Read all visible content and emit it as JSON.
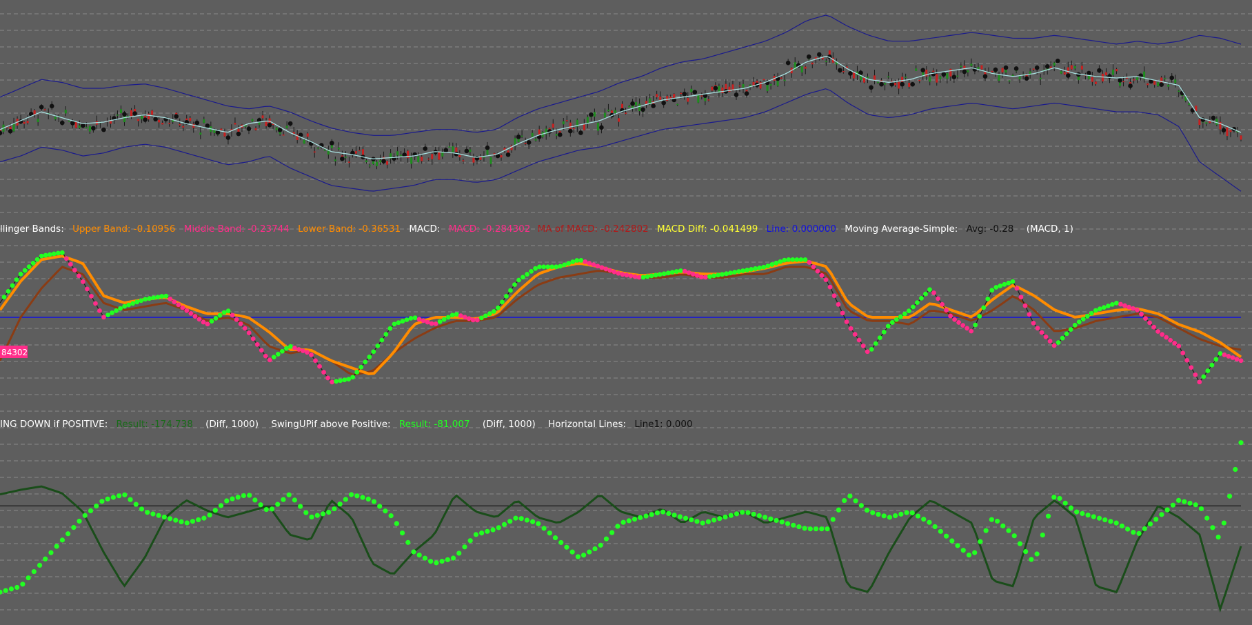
{
  "colors": {
    "background": "#5e5e5e",
    "grid": "#8a8a8a",
    "bollinger_band": "#1a1a8c",
    "middle_band": "#a8e0e0",
    "candle_up": "#1e8c1e",
    "candle_down": "#c82020",
    "candle_dot": "#111111",
    "macd": "#ff2d8a",
    "ma_of_macd": "#8a3c14",
    "macd_diff_line": "#ff8c00",
    "swing_dot": "#22ff22",
    "zero_line": "#1010e0",
    "result_line": "#1a4d1a",
    "black_line": "#111111"
  },
  "legend_macd": {
    "title": "llinger Bands:",
    "upper": "Upper Band: -0.10956",
    "middle": "Middle Band: -0.23744",
    "lower": "Lower Band: -0.36531",
    "macd_title": "MACD:",
    "macd": "MACD: -0.284302",
    "ma_macd": "MA of MACD: -0.242802",
    "diff": "MACD Diff: -0.041499",
    "line": "Line: 0.000000",
    "ma_title": "Moving Average-Simple:",
    "avg": "Avg: -0.28",
    "params": "(MACD, 1)",
    "value_tag": "84302"
  },
  "legend_swing": {
    "title": "ING DOWN if POSITIVE:",
    "result1": "Result: -174.738",
    "params1": "(Diff, 1000)",
    "title2": "SwingUPif above Positive:",
    "result2": "Result: -81.007",
    "params2": "(Diff, 1000)",
    "title3": "Horizontal Lines:",
    "line1": "Line1: 0.000"
  },
  "chart_data": [
    {
      "type": "line",
      "title": "",
      "description": "Price candles with Bollinger Bands (upper, middle, lower) — approximate normalized price",
      "x": [
        0,
        5,
        10,
        15,
        20,
        25,
        30,
        35,
        40,
        45,
        50,
        55,
        60,
        65,
        70,
        75,
        80,
        85,
        90,
        95,
        100,
        105,
        110,
        115,
        120,
        125,
        130,
        135,
        140,
        145,
        150,
        155,
        160,
        165,
        170,
        175,
        180,
        185,
        190,
        195,
        200,
        205,
        210,
        215,
        220,
        225,
        230,
        235,
        240,
        245,
        250,
        255,
        260,
        265,
        270,
        275,
        280,
        285,
        290,
        295,
        300
      ],
      "series": [
        {
          "name": "Middle Band",
          "values": [
            62,
            68,
            74,
            70,
            66,
            67,
            70,
            72,
            70,
            66,
            63,
            60,
            66,
            68,
            60,
            54,
            47,
            45,
            42,
            43,
            44,
            47,
            46,
            43,
            45,
            52,
            58,
            62,
            65,
            68,
            74,
            78,
            82,
            84,
            86,
            88,
            90,
            94,
            100,
            108,
            112,
            103,
            96,
            94,
            96,
            100,
            102,
            104,
            100,
            98,
            100,
            104,
            100,
            98,
            97,
            98,
            95,
            92,
            70,
            66,
            60
          ]
        },
        {
          "name": "Upper Band",
          "values": [
            84,
            90,
            96,
            94,
            90,
            90,
            92,
            93,
            90,
            86,
            82,
            78,
            76,
            78,
            74,
            68,
            63,
            60,
            58,
            58,
            60,
            62,
            62,
            60,
            62,
            70,
            76,
            80,
            84,
            88,
            94,
            98,
            104,
            108,
            110,
            114,
            118,
            122,
            128,
            136,
            140,
            132,
            126,
            122,
            122,
            124,
            126,
            128,
            126,
            124,
            124,
            126,
            124,
            122,
            120,
            122,
            120,
            122,
            126,
            124,
            120
          ]
        },
        {
          "name": "Lower Band",
          "values": [
            40,
            44,
            50,
            48,
            44,
            46,
            50,
            52,
            50,
            46,
            42,
            38,
            40,
            44,
            36,
            30,
            24,
            22,
            20,
            22,
            24,
            28,
            28,
            26,
            28,
            34,
            40,
            44,
            48,
            50,
            54,
            58,
            62,
            64,
            66,
            68,
            70,
            74,
            80,
            86,
            90,
            80,
            72,
            70,
            72,
            76,
            78,
            80,
            78,
            76,
            78,
            80,
            78,
            76,
            74,
            74,
            72,
            64,
            40,
            30,
            20
          ]
        }
      ],
      "xlabel": "",
      "ylabel": "",
      "ylim": [
        0,
        150
      ]
    },
    {
      "type": "line",
      "title": "",
      "description": "MACD panel — MACD line, MA of MACD, MACD Diff smoothing, zero line",
      "x": [
        0,
        5,
        10,
        15,
        20,
        25,
        30,
        35,
        40,
        45,
        50,
        55,
        60,
        65,
        70,
        75,
        80,
        85,
        90,
        95,
        100,
        105,
        110,
        115,
        120,
        125,
        130,
        135,
        140,
        145,
        150,
        155,
        160,
        165,
        170,
        175,
        180,
        185,
        190,
        195,
        200,
        205,
        210,
        215,
        220,
        225,
        230,
        235,
        240,
        245,
        250,
        255,
        260,
        265,
        270,
        275,
        280,
        285,
        290,
        295,
        300
      ],
      "series": [
        {
          "name": "MACD",
          "values": [
            0.2,
            0.6,
            0.85,
            0.9,
            0.5,
            0.0,
            0.15,
            0.25,
            0.3,
            0.1,
            -0.1,
            0.1,
            -0.2,
            -0.6,
            -0.4,
            -0.5,
            -0.9,
            -0.85,
            -0.5,
            -0.1,
            0.0,
            -0.1,
            0.05,
            -0.05,
            0.1,
            0.5,
            0.7,
            0.7,
            0.8,
            0.7,
            0.6,
            0.55,
            0.6,
            0.65,
            0.55,
            0.6,
            0.65,
            0.7,
            0.8,
            0.8,
            0.5,
            -0.1,
            -0.5,
            -0.1,
            0.1,
            0.4,
            0.0,
            -0.2,
            0.4,
            0.5,
            -0.1,
            -0.4,
            -0.1,
            0.1,
            0.2,
            0.1,
            -0.2,
            -0.4,
            -0.9,
            -0.5,
            -0.6
          ]
        },
        {
          "name": "MA of MACD",
          "values": [
            -0.6,
            0.0,
            0.4,
            0.7,
            0.6,
            0.2,
            0.1,
            0.15,
            0.2,
            0.1,
            -0.05,
            0.0,
            -0.1,
            -0.4,
            -0.5,
            -0.45,
            -0.6,
            -0.8,
            -0.75,
            -0.5,
            -0.3,
            -0.15,
            -0.05,
            -0.05,
            0.0,
            0.25,
            0.45,
            0.55,
            0.6,
            0.65,
            0.6,
            0.55,
            0.55,
            0.6,
            0.55,
            0.55,
            0.6,
            0.6,
            0.7,
            0.7,
            0.6,
            0.1,
            -0.05,
            -0.05,
            -0.1,
            0.1,
            0.05,
            -0.05,
            0.1,
            0.3,
            0.1,
            -0.2,
            -0.15,
            -0.05,
            0.0,
            0.05,
            0.0,
            -0.15,
            -0.3,
            -0.4,
            -0.45
          ]
        },
        {
          "name": "MACD Diff",
          "values": [
            0.1,
            0.5,
            0.8,
            0.85,
            0.75,
            0.3,
            0.2,
            0.25,
            0.28,
            0.15,
            0.05,
            0.05,
            0.0,
            -0.2,
            -0.45,
            -0.45,
            -0.6,
            -0.7,
            -0.8,
            -0.5,
            -0.1,
            0.0,
            0.0,
            -0.02,
            0.05,
            0.35,
            0.6,
            0.7,
            0.75,
            0.7,
            0.62,
            0.58,
            0.6,
            0.63,
            0.6,
            0.6,
            0.63,
            0.68,
            0.75,
            0.78,
            0.7,
            0.2,
            0.0,
            0.0,
            0.0,
            0.2,
            0.1,
            0.0,
            0.25,
            0.45,
            0.3,
            0.1,
            0.0,
            0.05,
            0.1,
            0.12,
            0.05,
            -0.1,
            -0.2,
            -0.35,
            -0.55
          ]
        },
        {
          "name": "Line",
          "values": [
            0,
            0,
            0,
            0,
            0,
            0,
            0,
            0,
            0,
            0,
            0,
            0,
            0,
            0,
            0,
            0,
            0,
            0,
            0,
            0,
            0,
            0,
            0,
            0,
            0,
            0,
            0,
            0,
            0,
            0,
            0,
            0,
            0,
            0,
            0,
            0,
            0,
            0,
            0,
            0,
            0,
            0,
            0,
            0,
            0,
            0,
            0,
            0,
            0,
            0,
            0,
            0,
            0,
            0,
            0,
            0,
            0,
            0,
            0,
            0,
            0
          ]
        }
      ],
      "xlabel": "",
      "ylabel": "",
      "ylim": [
        -1.1,
        1.1
      ]
    },
    {
      "type": "line",
      "title": "",
      "description": "Swing panel — Result (dark green line), SwingUP dots (green), Line1 zero",
      "x": [
        0,
        5,
        10,
        15,
        20,
        25,
        30,
        35,
        40,
        45,
        50,
        55,
        60,
        65,
        70,
        75,
        80,
        85,
        90,
        95,
        100,
        105,
        110,
        115,
        120,
        125,
        130,
        135,
        140,
        145,
        150,
        155,
        160,
        165,
        170,
        175,
        180,
        185,
        190,
        195,
        200,
        205,
        210,
        215,
        220,
        225,
        230,
        235,
        240,
        245,
        250,
        255,
        260,
        265,
        270,
        275,
        280,
        285,
        290,
        295,
        300
      ],
      "series": [
        {
          "name": "Result",
          "values": [
            20,
            28,
            34,
            22,
            -10,
            -80,
            -140,
            -90,
            -20,
            10,
            -8,
            -20,
            -10,
            0,
            -50,
            -60,
            10,
            -20,
            -100,
            -120,
            -80,
            -50,
            20,
            -10,
            -20,
            10,
            -20,
            -30,
            -10,
            20,
            -10,
            -20,
            -5,
            -30,
            -10,
            -20,
            -10,
            -30,
            -20,
            -10,
            -20,
            -140,
            -150,
            -80,
            -20,
            10,
            -10,
            -30,
            -130,
            -140,
            -20,
            10,
            -20,
            -140,
            -150,
            -60,
            0,
            -20,
            -50,
            -180,
            -70
          ]
        },
        {
          "name": "SwingUP",
          "values": [
            -150,
            -140,
            -100,
            -60,
            -20,
            10,
            20,
            -10,
            -20,
            -30,
            -20,
            10,
            20,
            -10,
            20,
            -20,
            -10,
            20,
            10,
            -20,
            -80,
            -100,
            -90,
            -50,
            -40,
            -20,
            -30,
            -60,
            -90,
            -70,
            -30,
            -20,
            -10,
            -20,
            -30,
            -20,
            -10,
            -20,
            -30,
            -40,
            -40,
            20,
            -10,
            -20,
            -10,
            -30,
            -60,
            -90,
            -20,
            -50,
            -100,
            20,
            -10,
            -20,
            -30,
            -50,
            -20,
            10,
            0,
            -60,
            110
          ]
        },
        {
          "name": "Line1",
          "values": [
            0,
            0,
            0,
            0,
            0,
            0,
            0,
            0,
            0,
            0,
            0,
            0,
            0,
            0,
            0,
            0,
            0,
            0,
            0,
            0,
            0,
            0,
            0,
            0,
            0,
            0,
            0,
            0,
            0,
            0,
            0,
            0,
            0,
            0,
            0,
            0,
            0,
            0,
            0,
            0,
            0,
            0,
            0,
            0,
            0,
            0,
            0,
            0,
            0,
            0,
            0,
            0,
            0,
            0,
            0,
            0,
            0,
            0,
            0,
            0,
            0
          ]
        }
      ],
      "xlabel": "",
      "ylabel": "",
      "ylim": [
        -200,
        130
      ]
    }
  ]
}
